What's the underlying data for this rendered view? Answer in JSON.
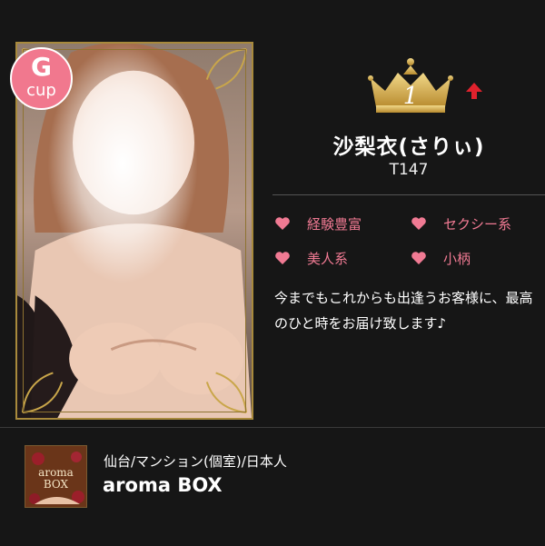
{
  "profile": {
    "cup_letter": "G",
    "cup_unit": "cup",
    "rank": "1",
    "name": "沙梨衣(さりぃ)",
    "height": "T147",
    "rank_change_icon": "arrow-up-icon",
    "tags": [
      {
        "label": "経験豊富",
        "icon": "heart-icon"
      },
      {
        "label": "セクシー系",
        "icon": "heart-icon"
      },
      {
        "label": "美人系",
        "icon": "heart-icon"
      },
      {
        "label": "小柄",
        "icon": "heart-icon"
      }
    ],
    "message": "今までもこれからも出逢うお客様に、最高のひと時をお届け致します♪"
  },
  "shop": {
    "area": "仙台/マンション(個室)/日本人",
    "name": "aroma BOX",
    "logo_text_line1": "aroma",
    "logo_text_line2": "BOX"
  },
  "colors": {
    "accent_pink": "#f07a93",
    "badge_pink": "#f1788e",
    "gold": "#c9a64a",
    "background": "#161616",
    "arrow_red": "#e0222d"
  }
}
